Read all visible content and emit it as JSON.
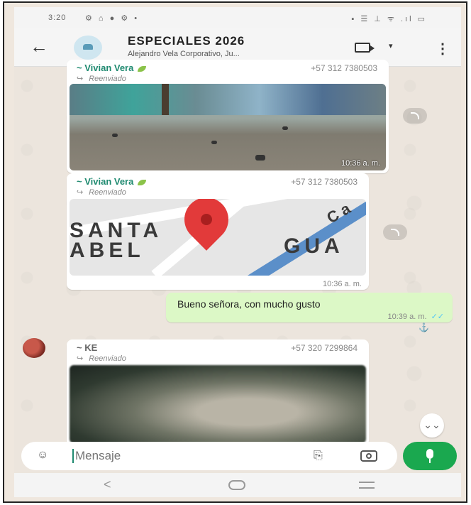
{
  "status_bar": {
    "time": "3:20",
    "left_icons": "⚙ ⌂ ● ⚙ •",
    "right_icons": "▪ ☰ ⊥ ᯤ .ıl ▭"
  },
  "header": {
    "title": "ESPECIALES 2026",
    "subtitle": "Alejandro Vela Corporativo, Ju..."
  },
  "messages": [
    {
      "sender": "~ Vivian Vera",
      "phone": "+57 312 7380503",
      "forwarded": "Reenviado",
      "type": "image",
      "time": "10:36 a. m."
    },
    {
      "sender": "~ Vivian Vera",
      "phone": "+57 312 7380503",
      "forwarded": "Reenviado",
      "type": "location",
      "map_labels": {
        "santa": "SANTA",
        "abel": "ABEL",
        "gua": "GUA",
        "ca": "Ca"
      },
      "time": "10:36 a. m."
    },
    {
      "type": "outgoing",
      "text": "Bueno señora, con mucho gusto",
      "time": "10:39 a. m.",
      "ticks": "✓✓",
      "reaction": "⚓"
    },
    {
      "sender": "~ KE",
      "phone": "+57 320 7299864",
      "forwarded": "Reenviado",
      "type": "image"
    }
  ],
  "input": {
    "placeholder": "Mensaje"
  },
  "icons": {
    "back": "←",
    "menu": "⋮",
    "caret": "▾",
    "fwd_arrow": "↪",
    "emoji": "☺",
    "attach": "⎘",
    "scroll_down": "⌄⌄",
    "nav_back": "<"
  },
  "colors": {
    "accent": "#1aa84f",
    "sender": "#1f8a70",
    "outgoing": "#dcf8c6",
    "pin": "#e23a3a"
  }
}
